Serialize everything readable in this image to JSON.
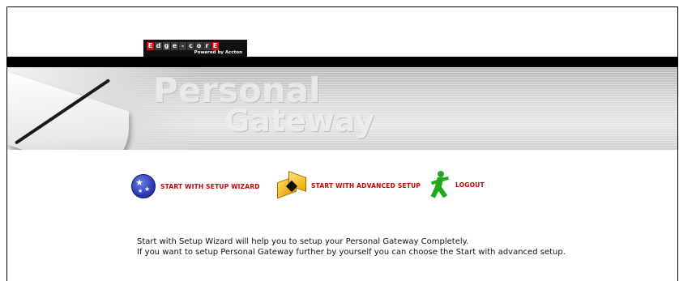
{
  "logo": {
    "letters": [
      "E",
      "d",
      "g",
      "e",
      "-",
      "c",
      "o",
      "r",
      "E"
    ],
    "tagline": "Powered by Accton"
  },
  "banner": {
    "title_line1": "Personal",
    "title_line2": "Gateway"
  },
  "nav": {
    "wizard": {
      "label": "Start with Setup Wizard",
      "icon": "globe-star-icon"
    },
    "advanced": {
      "label": "Start with Advanced Setup",
      "icon": "puzzle-icon"
    },
    "logout": {
      "label": "Logout",
      "icon": "running-man-icon"
    }
  },
  "description": {
    "line1": "Start with Setup Wizard will help you to setup your Personal Gateway Completely.",
    "line2": "If you want to setup Personal Gateway further by yourself you can choose the Start with advanced setup."
  },
  "colors": {
    "accent_red": "#cc0000",
    "logout_green": "#22a81c"
  }
}
